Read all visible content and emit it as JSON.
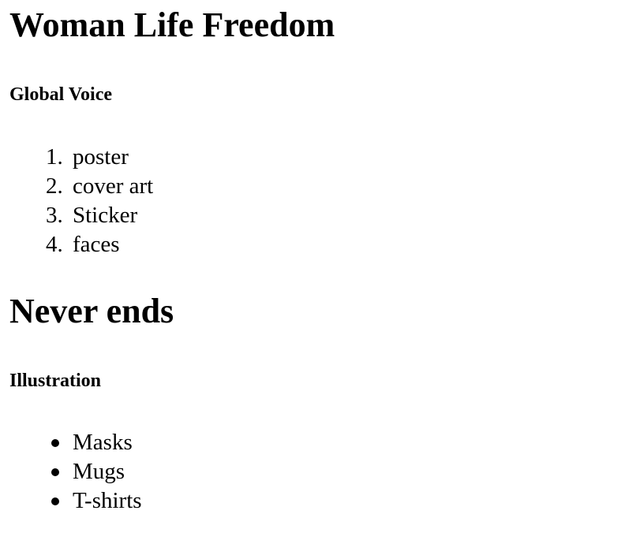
{
  "document": {
    "title": "Woman Life Freedom",
    "section1": {
      "subtitle": "Global Voice",
      "ordered_items": [
        {
          "marker": "1.",
          "label": "poster"
        },
        {
          "marker": "2.",
          "label": "cover art"
        },
        {
          "marker": "3.",
          "label": "Sticker"
        },
        {
          "marker": "4.",
          "label": "faces"
        }
      ]
    },
    "section2": {
      "heading": "Never ends",
      "subtitle": "Illustration",
      "bullet_items": [
        {
          "label": "Masks"
        },
        {
          "label": "Mugs"
        },
        {
          "label": "T-shirts"
        }
      ]
    }
  }
}
